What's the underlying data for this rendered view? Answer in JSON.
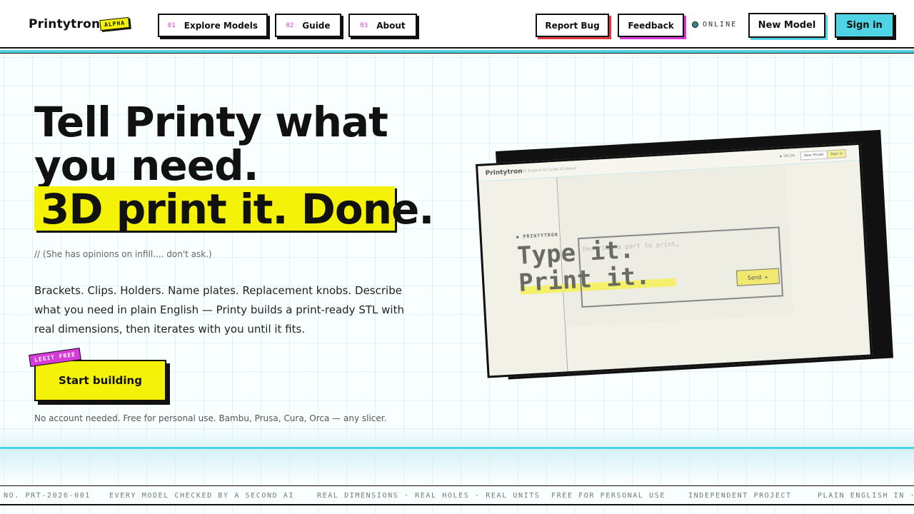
{
  "header": {
    "brand": "Printytron",
    "badge": "ALPHA",
    "nav": [
      {
        "num": "01",
        "label": "Explore Models"
      },
      {
        "num": "02",
        "label": "Guide"
      },
      {
        "num": "03",
        "label": "About"
      }
    ],
    "report_bug": "Report Bug",
    "feedback": "Feedback",
    "status": "ONLINE",
    "new_model": "New Model",
    "sign_in": "Sign in"
  },
  "hero": {
    "line1": "Tell Printy what",
    "line2": "you need.",
    "line3": "3D print it. Done.",
    "aside": "// (She has opinions on infill.... don't ask.)",
    "description": "Brackets. Clips. Holders. Name plates. Replacement knobs. Describe what you need in plain English — Printy builds a print-ready STL with real dimensions, then iterates with you until it fits.",
    "cta": "Start building",
    "cta_badge": "LEGIT FREE",
    "footnote": "No account needed. Free for personal use. Bambu, Prusa, Cura, Orca — any slicer."
  },
  "preview": {
    "brand": "Printytron",
    "nav": "01 Explore  02 Guide  03 About",
    "status": "● ONLINE",
    "new_model": "New Model",
    "sign_in": "Sign in",
    "small_brand": "◉ PRINTYTRON",
    "title_line1": "Type it.",
    "title_line2": "Print it.",
    "placeholder": "Describe a part to print…",
    "send": "Send ▸"
  },
  "ticker": [
    "NO. PRT-2026-001",
    "EVERY MODEL CHECKED BY A SECOND AI",
    "REAL DIMENSIONS · REAL HOLES · REAL UNITS",
    "FREE FOR PERSONAL USE",
    "INDEPENDENT PROJECT",
    "PLAIN ENGLISH IN · P"
  ],
  "colors": {
    "accent_yellow": "#f5f20a",
    "accent_cyan": "#4ed4e4",
    "accent_magenta": "#d63ad9",
    "report_bug_shadow": "#e23b3b",
    "status_dot": "#2e8f86"
  }
}
